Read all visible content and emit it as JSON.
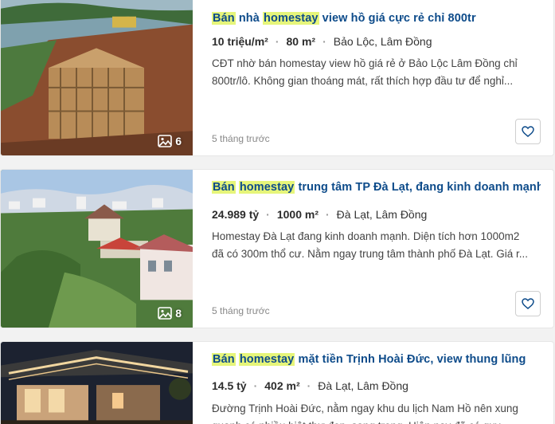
{
  "listings": [
    {
      "title_parts": [
        "Bán",
        " nhà ",
        "homestay",
        " view hồ giá cực rẻ chỉ 800tr"
      ],
      "price": "10 triệu/m²",
      "area": "80 m²",
      "location": "Bảo Lộc, Lâm Đồng",
      "description": "CĐT nhờ bán homestay view hồ giá rẻ ở Bảo Lộc Lâm Đồng chỉ 800tr/lô. Không gian thoáng mát, rất thích hợp đầu tư để nghỉ...",
      "time": "5 tháng trước",
      "photo_count": "6"
    },
    {
      "title_parts": [
        "Bán",
        " ",
        "homestay",
        " trung tâm TP Đà Lạt, đang kinh doanh mạnh"
      ],
      "price": "24.989 tỷ",
      "area": "1000 m²",
      "location": "Đà Lạt, Lâm Đồng",
      "description": "Homestay Đà Lạt đang kinh doanh mạnh. Diện tích hơn 1000m2 đã có 300m thổ cư. Nằm ngay trung tâm thành phố Đà Lạt. Giá r...",
      "time": "5 tháng trước",
      "photo_count": "8"
    },
    {
      "title_parts": [
        "Bán",
        " ",
        "homestay",
        " mặt tiền Trịnh Hoài Đức, view thung lũng"
      ],
      "price": "14.5 tỷ",
      "area": "402 m²",
      "location": "Đà Lạt, Lâm Đồng",
      "description": "Đường Trịnh Hoài Đức, nằm ngay khu du lịch Nam Hồ nên xung quanh có nhiều biệt thự đẹp, sang trọng. Hiện nay đã có quy định...",
      "time": "",
      "photo_count": ""
    }
  ],
  "colors": {
    "title": "#0d4b8a",
    "highlight": "#e6f57a"
  },
  "icons": {
    "photo": "image-gallery-icon",
    "favorite": "heart-outline-icon"
  }
}
